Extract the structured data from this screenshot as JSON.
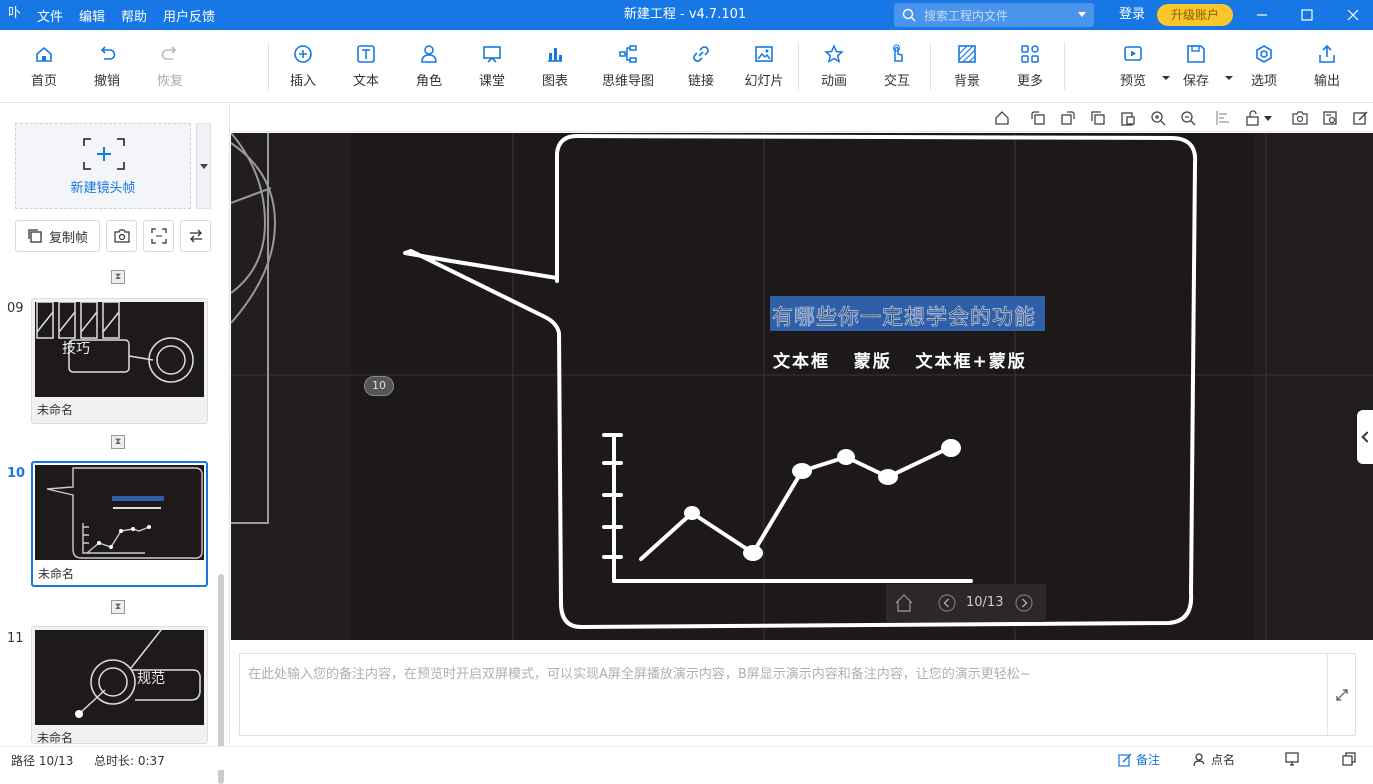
{
  "titlebar": {
    "logo": "卟",
    "menus": [
      "文件",
      "编辑",
      "帮助",
      "用户反馈"
    ],
    "title": "新建工程 - v4.7.101",
    "search_placeholder": "搜索工程内文件",
    "login": "登录",
    "upgrade": "升级账户"
  },
  "toolbar": {
    "home": "首页",
    "undo": "撤销",
    "redo": "恢复",
    "insert": "插入",
    "text": "文本",
    "role": "角色",
    "classroom": "课堂",
    "chart": "图表",
    "mindmap": "思维导图",
    "link": "链接",
    "slides": "幻灯片",
    "animation": "动画",
    "interaction": "交互",
    "background": "背景",
    "more": "更多",
    "preview": "预览",
    "save": "保存",
    "options": "选项",
    "export": "输出"
  },
  "sidebar": {
    "new_frame": "新建镜头帧",
    "copy_frame": "复制帧",
    "frames": [
      {
        "num": "09",
        "name": "未命名",
        "label": "技巧"
      },
      {
        "num": "10",
        "name": "未命名",
        "active": true
      },
      {
        "num": "11",
        "name": "未命名",
        "label": "规范"
      }
    ]
  },
  "canvas": {
    "heading": "有哪些你一定想学会的功能",
    "subline": "文本框   蒙版   文本框+蒙版",
    "frame_badge": "10",
    "pager": "10/13"
  },
  "notes": {
    "placeholder": "在此处输入您的备注内容，在预览时开启双屏模式，可以实现A屏全屏播放演示内容，B屏显示演示内容和备注内容，让您的演示更轻松~"
  },
  "status": {
    "path": "路径 10/13",
    "duration": "总时长: 0:37",
    "notes": "备注",
    "rollcall": "点名"
  },
  "colors": {
    "primary": "#1677e5",
    "canvas_bg": "#2a2424",
    "upgrade": "#f9c72b",
    "highlight": "#2f5fa8"
  }
}
